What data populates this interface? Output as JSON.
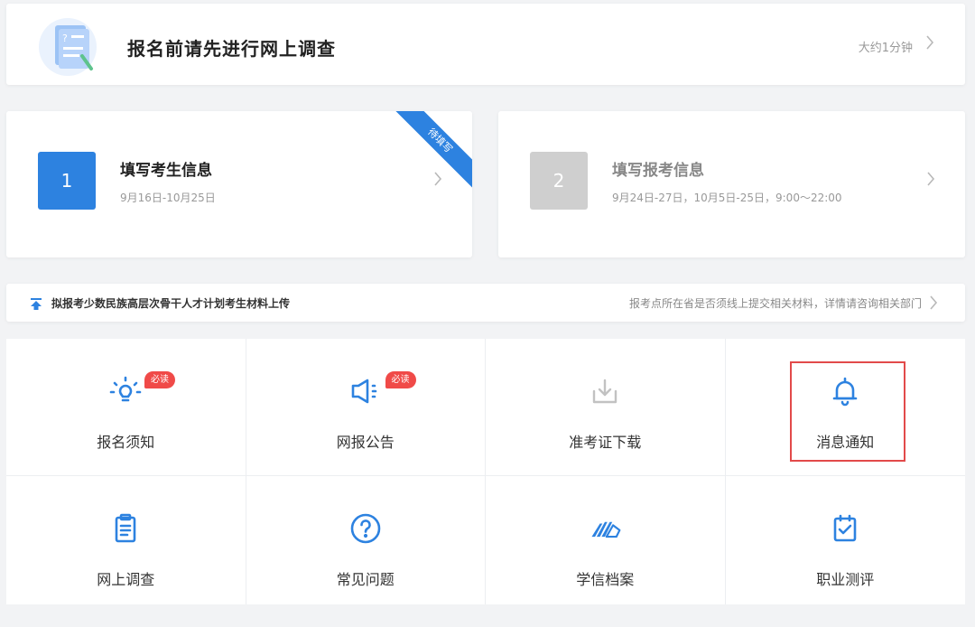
{
  "survey": {
    "title": "报名前请先进行网上调查",
    "time": "大约1分钟"
  },
  "steps": [
    {
      "number": "1",
      "title": "填写考生信息",
      "date": "9月16日-10月25日",
      "ribbon": "待填写"
    },
    {
      "number": "2",
      "title": "填写报考信息",
      "date": "9月24日-27日，10月5日-25日，9:00～22:00"
    }
  ],
  "notice": {
    "left": "拟报考少数民族高层次骨干人才计划考生材料上传",
    "right": "报考点所在省是否须线上提交相关材料，详情请咨询相关部门"
  },
  "grid": [
    {
      "label": "报名须知",
      "icon": "lightbulb-icon",
      "badge": "必读"
    },
    {
      "label": "网报公告",
      "icon": "megaphone-icon",
      "badge": "必读"
    },
    {
      "label": "准考证下载",
      "icon": "download-icon"
    },
    {
      "label": "消息通知",
      "icon": "bell-icon"
    },
    {
      "label": "网上调查",
      "icon": "clipboard-icon"
    },
    {
      "label": "常见问题",
      "icon": "question-icon"
    },
    {
      "label": "学信档案",
      "icon": "archive-icon"
    },
    {
      "label": "职业测评",
      "icon": "assessment-icon"
    }
  ],
  "colors": {
    "accent": "#2d82e0",
    "badge": "#f04a48",
    "highlight": "#e24a4a",
    "disabled": "#cfcfcf"
  }
}
